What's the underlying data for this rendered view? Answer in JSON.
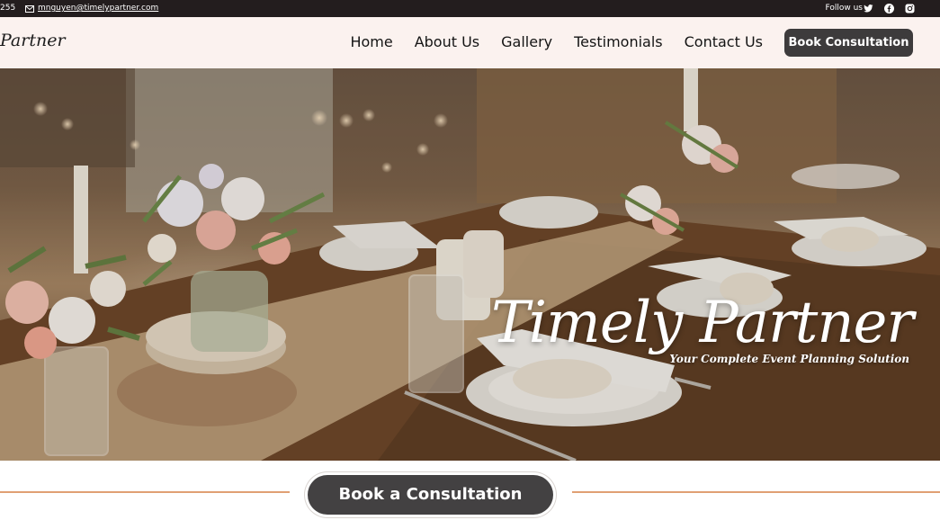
{
  "topbar": {
    "phone_fragment": "255",
    "email": "mnguyen@timelypartner.com",
    "follow_label": "Follow us",
    "socials": [
      "twitter-icon",
      "facebook-icon",
      "instagram-icon"
    ]
  },
  "nav": {
    "logo": "Partner",
    "menu": [
      "Home",
      "About Us",
      "Gallery",
      "Testimonials",
      "Contact Us"
    ],
    "cta": "Book Consultation"
  },
  "hero": {
    "title": "Timely Partner",
    "subtitle": "Your Complete Event Planning Solution"
  },
  "cta": {
    "label": "Book a Consultation"
  },
  "colors": {
    "topbar_bg": "#231d1e",
    "nav_bg": "#fbf2ef",
    "button_bg": "#3d3b3c",
    "accent_line": "#e0a074"
  }
}
